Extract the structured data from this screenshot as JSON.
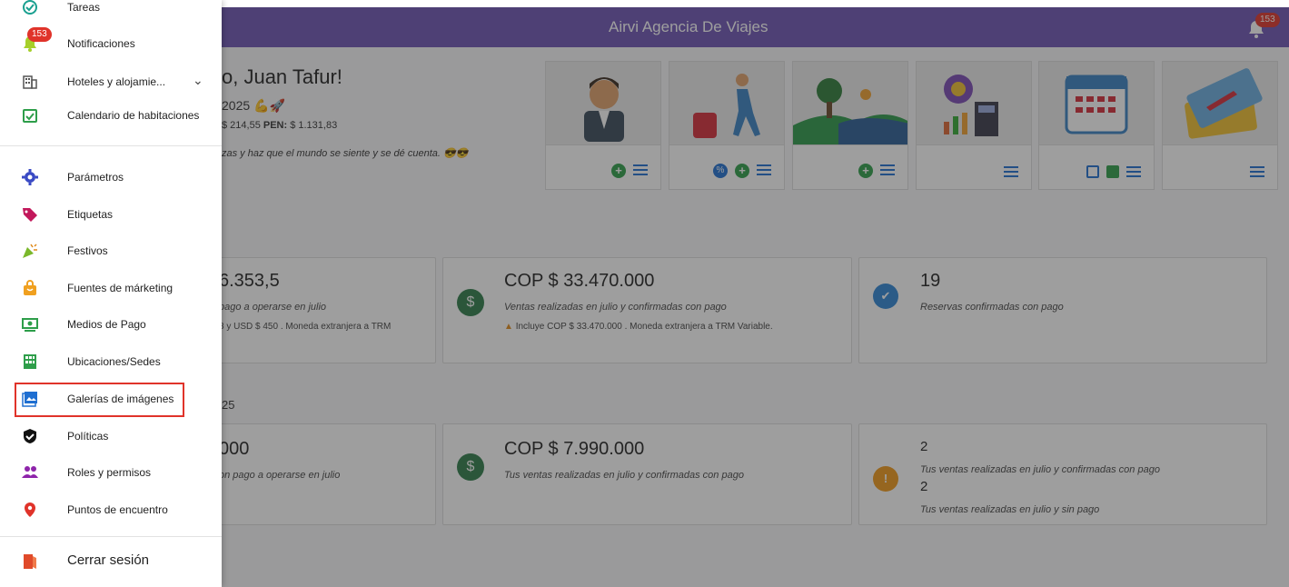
{
  "app": {
    "title": "Airvi Agencia De Viajes",
    "notification_count": "153"
  },
  "drawer": {
    "items": [
      {
        "label": "Tareas"
      },
      {
        "label": "Notificaciones",
        "badge": "153"
      },
      {
        "label": "Hoteles y alojamie..."
      },
      {
        "label": "Calendario de habitaciones"
      },
      {
        "label": "Parámetros"
      },
      {
        "label": "Etiquetas"
      },
      {
        "label": "Festivos"
      },
      {
        "label": "Fuentes de márketing"
      },
      {
        "label": "Medios de Pago"
      },
      {
        "label": "Ubicaciones/Sedes"
      },
      {
        "label": "Galerías de imágenes"
      },
      {
        "label": "Políticas"
      },
      {
        "label": "Roles y permisos"
      },
      {
        "label": "Puntos de encuentro"
      },
      {
        "label": "Cerrar sesión"
      }
    ]
  },
  "welcome": {
    "greeting": "o, Juan Tafur!",
    "date": "2025 💪🚀",
    "rates_pre": "$ 214,55 ",
    "rates_pen_label": "PEN:",
    "rates_pen_value": " $ 1.131,83",
    "quote": "zas y haz que el mundo se siente y se dé cuenta. 😎😎"
  },
  "summary1": {
    "card1": {
      "value": "6.353,5",
      "desc": "pago a operarse en julio",
      "note": "8 y USD $ 450 . Moneda extranjera a TRM"
    },
    "card2": {
      "value": "COP $ 33.470.000",
      "desc": "Ventas realizadas en julio y confirmadas con pago",
      "note": "Incluye COP $ 33.470.000 . Moneda extranjera a TRM Variable."
    },
    "card3": {
      "value": "19",
      "desc": "Reservas confirmadas con pago"
    }
  },
  "section2_label": "25",
  "summary2": {
    "card1": {
      "value": "000",
      "desc": "on pago a operarse en julio"
    },
    "card2": {
      "value": "COP $ 7.990.000",
      "desc": "Tus ventas realizadas en julio y confirmadas con pago"
    },
    "card3": {
      "value1": "2",
      "desc1": "Tus ventas realizadas en julio y confirmadas con pago",
      "value2": "2",
      "desc2": "Tus ventas realizadas en julio y sin pago"
    }
  },
  "colors": {
    "header": "#6e54b4",
    "highlight": "#e0332a",
    "badge": "#e0332a"
  }
}
